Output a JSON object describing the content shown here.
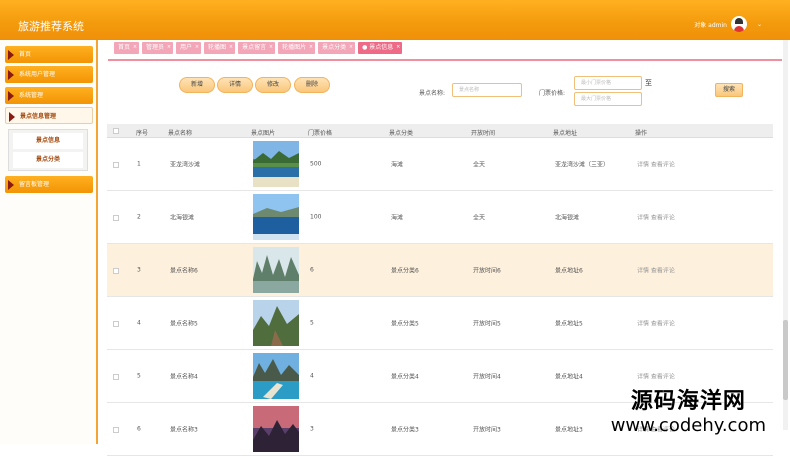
{
  "app": {
    "title": "旅游推荐系统",
    "user": "对象 admin"
  },
  "sidebar": {
    "items": [
      {
        "label": "首页"
      },
      {
        "label": "系统用户管理"
      },
      {
        "label": "系统管理"
      },
      {
        "label": "景点信息管理"
      },
      {
        "label": "留言板管理"
      }
    ],
    "submenu": [
      {
        "label": "景点信息"
      },
      {
        "label": "景点分类"
      }
    ]
  },
  "tabs": [
    {
      "label": "首页"
    },
    {
      "label": "管理员"
    },
    {
      "label": "用户"
    },
    {
      "label": "轮播图"
    },
    {
      "label": "景点留言"
    },
    {
      "label": "轮播图片"
    },
    {
      "label": "景点分类"
    },
    {
      "label": "● 景点信息"
    }
  ],
  "toolbar": {
    "add": "新增",
    "detail": "详情",
    "edit": "修改",
    "delete": "删除",
    "search": "搜索"
  },
  "search": {
    "name_label": "景点名称:",
    "name_placeholder": "景点名称",
    "price_label": "门票价格:",
    "price_min_placeholder": "最小门票价格",
    "price_max_placeholder": "最大门票价格",
    "to": "至"
  },
  "table": {
    "headers": [
      "序号",
      "景点名称",
      "景点图片",
      "门票价格",
      "景点分类",
      "开放时间",
      "景点地址",
      "操作"
    ],
    "rows": [
      {
        "no": "1",
        "name": "亚龙湾沙滩",
        "price": "500",
        "category": "海滩",
        "open": "全天",
        "address": "亚龙湾沙滩（三亚）",
        "actions": "详情  查看评论"
      },
      {
        "no": "2",
        "name": "北海银滩",
        "price": "100",
        "category": "海滩",
        "open": "全天",
        "address": "北海银滩",
        "actions": "详情  查看评论"
      },
      {
        "no": "3",
        "name": "景点名称6",
        "price": "6",
        "category": "景点分类6",
        "open": "开放时间6",
        "address": "景点地址6",
        "actions": "详情  查看评论"
      },
      {
        "no": "4",
        "name": "景点名称5",
        "price": "5",
        "category": "景点分类5",
        "open": "开放时间5",
        "address": "景点地址5",
        "actions": "详情  查看评论"
      },
      {
        "no": "5",
        "name": "景点名称4",
        "price": "4",
        "category": "景点分类4",
        "open": "开放时间4",
        "address": "景点地址4",
        "actions": "详情  查看评论"
      },
      {
        "no": "6",
        "name": "景点名称3",
        "price": "3",
        "category": "景点分类3",
        "open": "开放时间3",
        "address": "景点地址3",
        "actions": "详情  查看评论"
      }
    ]
  },
  "watermark": {
    "cn": "源码海洋网",
    "url": "www.codehy.com"
  }
}
